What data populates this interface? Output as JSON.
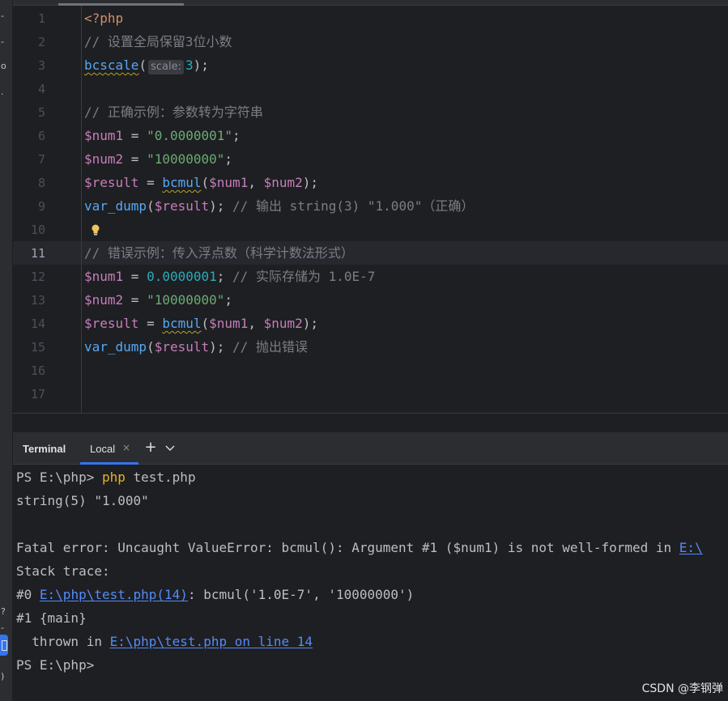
{
  "editor": {
    "lines": [
      {
        "n": "1",
        "parts": [
          {
            "t": "<?php",
            "c": "kw"
          }
        ]
      },
      {
        "n": "2",
        "parts": [
          {
            "t": "// 设置全局保留3位小数",
            "c": "cm"
          }
        ]
      },
      {
        "n": "3",
        "parts": [
          {
            "t": "bcscale",
            "c": "fn squiggle"
          },
          {
            "t": "(",
            "c": ""
          },
          {
            "t": "scale:",
            "c": "hint"
          },
          {
            "t": "3",
            "c": "num"
          },
          {
            "t": ");",
            "c": ""
          }
        ]
      },
      {
        "n": "4",
        "parts": []
      },
      {
        "n": "5",
        "parts": [
          {
            "t": "// 正确示例：参数转为字符串",
            "c": "cm"
          }
        ]
      },
      {
        "n": "6",
        "parts": [
          {
            "t": "$num1",
            "c": "var"
          },
          {
            "t": " = ",
            "c": ""
          },
          {
            "t": "\"0.0000001\"",
            "c": "str"
          },
          {
            "t": ";",
            "c": ""
          }
        ]
      },
      {
        "n": "7",
        "parts": [
          {
            "t": "$num2",
            "c": "var"
          },
          {
            "t": " = ",
            "c": ""
          },
          {
            "t": "\"10000000\"",
            "c": "str"
          },
          {
            "t": ";",
            "c": ""
          }
        ]
      },
      {
        "n": "8",
        "parts": [
          {
            "t": "$result",
            "c": "var"
          },
          {
            "t": " = ",
            "c": ""
          },
          {
            "t": "bcmul",
            "c": "fn squiggle"
          },
          {
            "t": "(",
            "c": ""
          },
          {
            "t": "$num1",
            "c": "var"
          },
          {
            "t": ", ",
            "c": ""
          },
          {
            "t": "$num2",
            "c": "var"
          },
          {
            "t": ");",
            "c": ""
          }
        ]
      },
      {
        "n": "9",
        "parts": [
          {
            "t": "var_dump",
            "c": "fn"
          },
          {
            "t": "(",
            "c": ""
          },
          {
            "t": "$result",
            "c": "var"
          },
          {
            "t": "); ",
            "c": ""
          },
          {
            "t": "// 输出 string(3) \"1.000\"（正确）",
            "c": "cm"
          }
        ]
      },
      {
        "n": "10",
        "parts": []
      },
      {
        "n": "11",
        "current": true,
        "parts": [
          {
            "t": "// 错误示例：传入浮点数（科学计数法形式）",
            "c": "cm"
          }
        ]
      },
      {
        "n": "12",
        "parts": [
          {
            "t": "$num1",
            "c": "var"
          },
          {
            "t": " = ",
            "c": ""
          },
          {
            "t": "0.0000001",
            "c": "num"
          },
          {
            "t": "; ",
            "c": ""
          },
          {
            "t": "// 实际存储为 1.0E-7",
            "c": "cm"
          }
        ]
      },
      {
        "n": "13",
        "parts": [
          {
            "t": "$num2",
            "c": "var"
          },
          {
            "t": " = ",
            "c": ""
          },
          {
            "t": "\"10000000\"",
            "c": "str"
          },
          {
            "t": ";",
            "c": ""
          }
        ]
      },
      {
        "n": "14",
        "parts": [
          {
            "t": "$result",
            "c": "var"
          },
          {
            "t": " = ",
            "c": ""
          },
          {
            "t": "bcmul",
            "c": "fn squiggle"
          },
          {
            "t": "(",
            "c": ""
          },
          {
            "t": "$num1",
            "c": "var"
          },
          {
            "t": ", ",
            "c": ""
          },
          {
            "t": "$num2",
            "c": "var"
          },
          {
            "t": ");",
            "c": ""
          }
        ]
      },
      {
        "n": "15",
        "parts": [
          {
            "t": "var_dump",
            "c": "fn"
          },
          {
            "t": "(",
            "c": ""
          },
          {
            "t": "$result",
            "c": "var"
          },
          {
            "t": "); ",
            "c": ""
          },
          {
            "t": "// 抛出错误",
            "c": "cm"
          }
        ]
      },
      {
        "n": "16",
        "parts": []
      },
      {
        "n": "17",
        "parts": []
      }
    ],
    "intention_bulb_icon": "lightbulb-icon"
  },
  "left_strip": {
    "glyphs": [
      "-",
      "-",
      "o",
      ".",
      "?",
      "-",
      ")",
      ")"
    ]
  },
  "terminal": {
    "title": "Terminal",
    "tab_label": "Local",
    "tab_close": "×",
    "add_tab": "+",
    "lines": [
      {
        "parts": [
          {
            "t": "PS E:\\php> ",
            "c": ""
          },
          {
            "t": "php",
            "c": "cmd"
          },
          {
            "t": " test.php",
            "c": ""
          }
        ]
      },
      {
        "parts": [
          {
            "t": "string(5) \"1.000\"",
            "c": ""
          }
        ]
      },
      {
        "parts": []
      },
      {
        "parts": [
          {
            "t": "Fatal error: Uncaught ValueError: bcmul(): Argument #1 ($num1) is not well-formed in ",
            "c": ""
          },
          {
            "t": "E:\\",
            "c": "link"
          }
        ]
      },
      {
        "parts": [
          {
            "t": "Stack trace:",
            "c": ""
          }
        ]
      },
      {
        "parts": [
          {
            "t": "#0 ",
            "c": ""
          },
          {
            "t": "E:\\php\\test.php(14)",
            "c": "link"
          },
          {
            "t": ": bcmul('1.0E-7', '10000000')",
            "c": ""
          }
        ]
      },
      {
        "parts": [
          {
            "t": "#1 {main}",
            "c": ""
          }
        ]
      },
      {
        "parts": [
          {
            "t": "  thrown in ",
            "c": ""
          },
          {
            "t": "E:\\php\\test.php on line 14",
            "c": "link"
          }
        ]
      },
      {
        "parts": [
          {
            "t": "PS E:\\php>",
            "c": ""
          }
        ]
      }
    ]
  },
  "watermark": "CSDN @李钢弹",
  "colors": {
    "background": "#1e1f22",
    "panel": "#2b2d30",
    "keyword": "#cf8e6d",
    "comment": "#7a7e85",
    "variable": "#c77dbb",
    "string": "#6aab73",
    "number": "#2aacb8",
    "function": "#56a8f5",
    "link": "#548af7",
    "accent": "#3574f0"
  }
}
